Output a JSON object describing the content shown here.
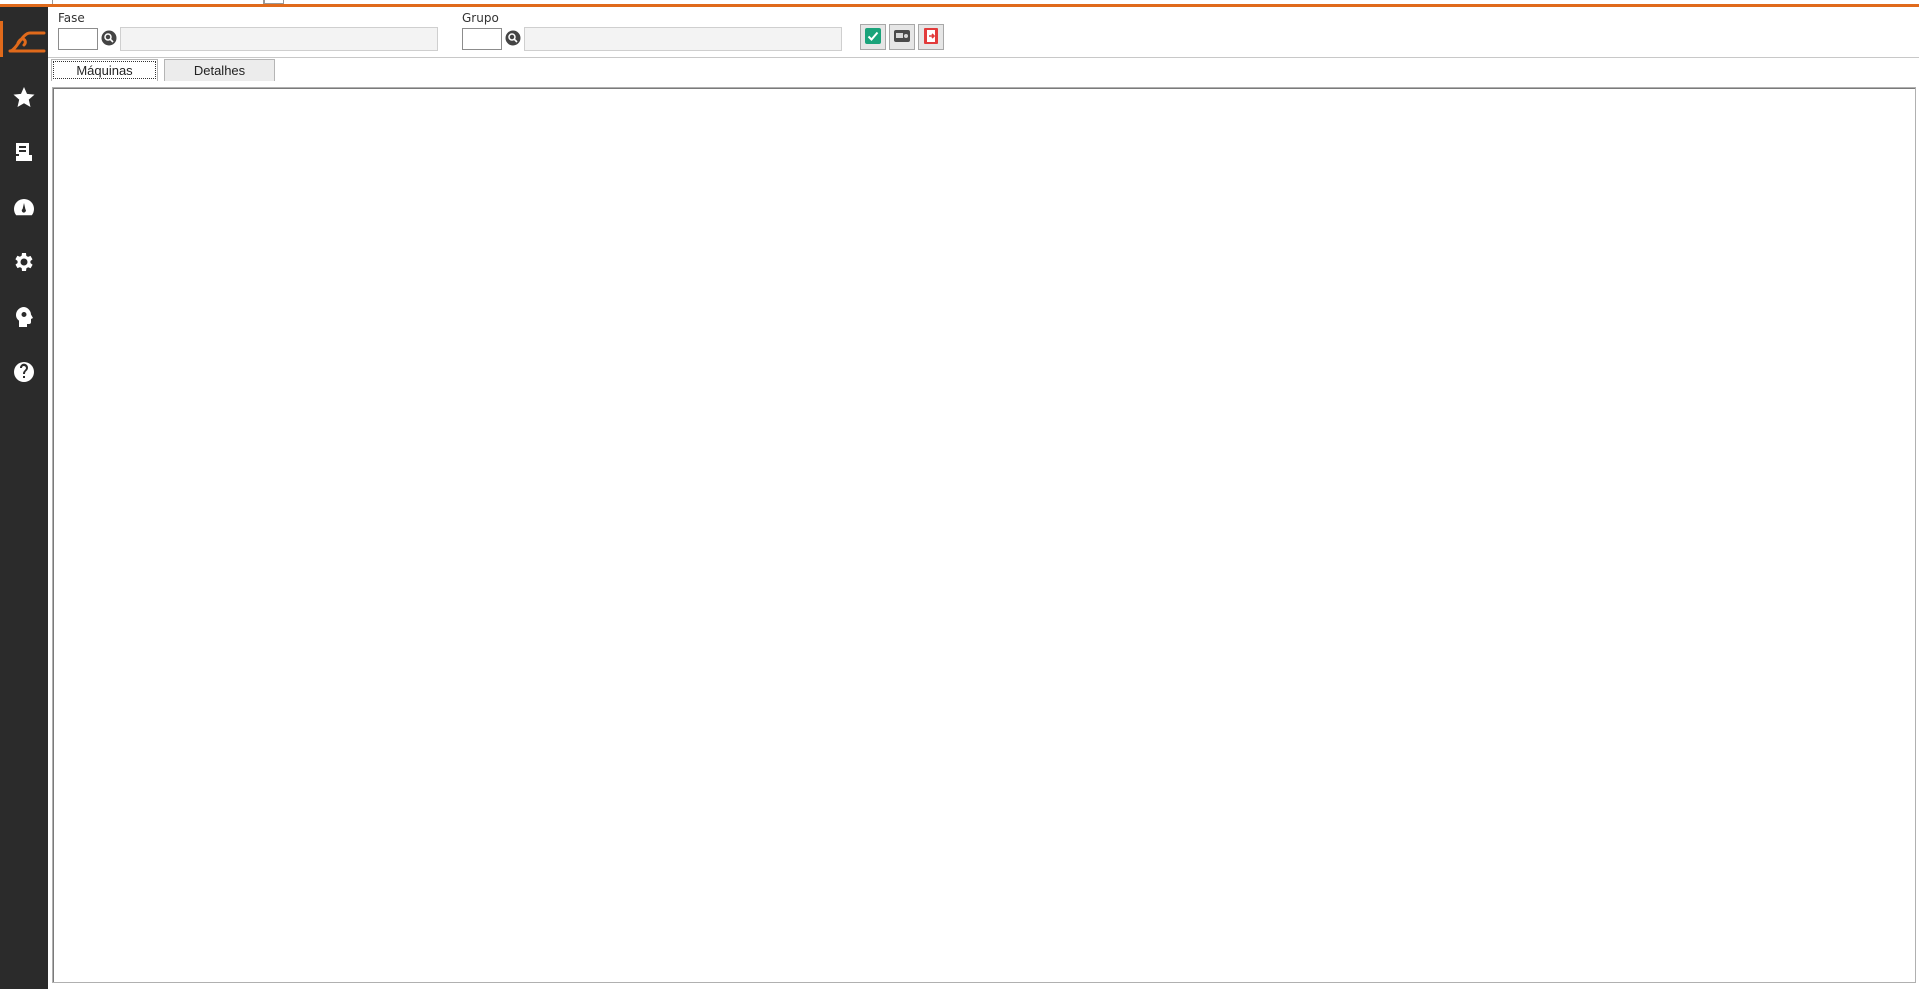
{
  "filters": {
    "fase": {
      "label": "Fase",
      "code_value": "",
      "description_value": ""
    },
    "grupo": {
      "label": "Grupo",
      "code_value": "",
      "description_value": ""
    }
  },
  "sidebar": {
    "icons": [
      "star-icon",
      "report-icon",
      "dashboard-icon",
      "gear-icon",
      "head-gear-icon",
      "help-icon"
    ]
  },
  "toolbar": {
    "buttons": [
      "confirm-check-icon",
      "machine-icon",
      "exit-icon"
    ]
  },
  "tabs": [
    {
      "label": "Máquinas",
      "active": true
    },
    {
      "label": "Detalhes",
      "active": false
    }
  ],
  "colors": {
    "accent": "#e06a1b",
    "sidebar_bg": "#2b2b2b",
    "confirm_green": "#1aa37a",
    "exit_red": "#e23b3b"
  }
}
